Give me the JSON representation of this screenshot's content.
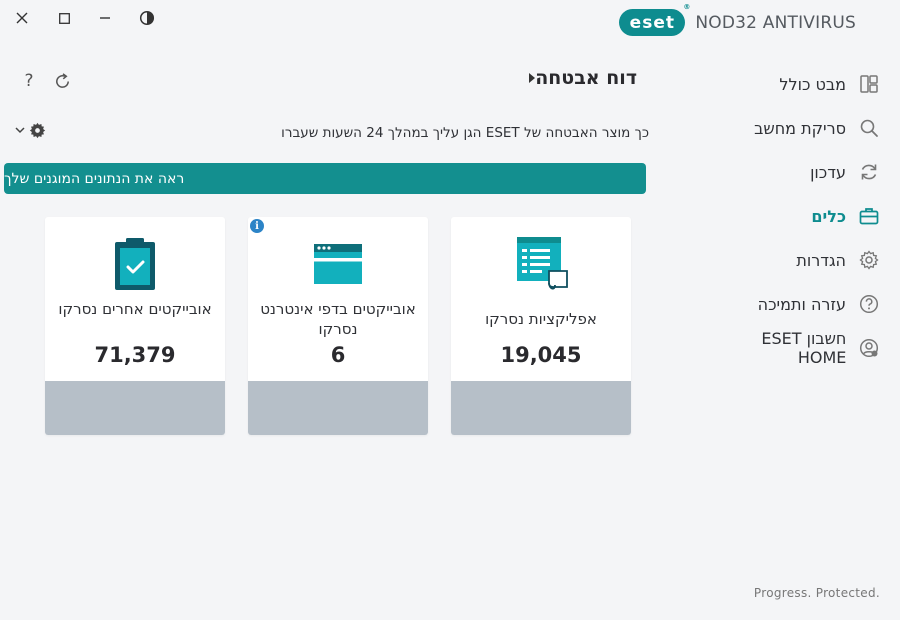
{
  "window": {
    "close_icon": "close-icon",
    "maximize_icon": "maximize-icon",
    "minimize_icon": "minimize-icon",
    "theme_icon": "theme-contrast-icon"
  },
  "brand": {
    "logo_text": "eset",
    "product_name": "NOD32 ANTIVIRUS",
    "accent_color": "#0e8c8f"
  },
  "sidebar": {
    "items": [
      {
        "label": "מבט כולל",
        "icon": "dashboard-icon",
        "active": false
      },
      {
        "label": "סריקת מחשב",
        "icon": "search-icon",
        "active": false
      },
      {
        "label": "עדכון",
        "icon": "refresh-icon",
        "active": false
      },
      {
        "label": "כלים",
        "icon": "briefcase-icon",
        "active": true
      },
      {
        "label": "הגדרות",
        "icon": "gear-icon",
        "active": false
      },
      {
        "label": "עזרה ותמיכה",
        "icon": "help-icon",
        "active": false
      },
      {
        "label": "חשבון ESET HOME",
        "icon": "account-icon",
        "active": false
      }
    ]
  },
  "header": {
    "title": "דוח אבטחה",
    "help_label": "?"
  },
  "subtitle": "כך מוצר האבטחה של ESET הגן עליך במהלך 24 השעות שעברו",
  "banner": {
    "text": "ראה את הנתונים המוגנים שלך",
    "color": "#138f8f"
  },
  "cards": [
    {
      "label": "אפליקציות נסרקו",
      "count": "19,045",
      "icon": "applications-icon"
    },
    {
      "label": "אובייקטים בדפי אינטרנט נסרקו",
      "count": "6",
      "icon": "webpage-icon",
      "info_label": "i"
    },
    {
      "label": "אובייקטים אחרים נסרקו",
      "count": "71,379",
      "icon": "clipboard-check-icon"
    }
  ],
  "footer": {
    "tagline": "Progress. Protected."
  }
}
